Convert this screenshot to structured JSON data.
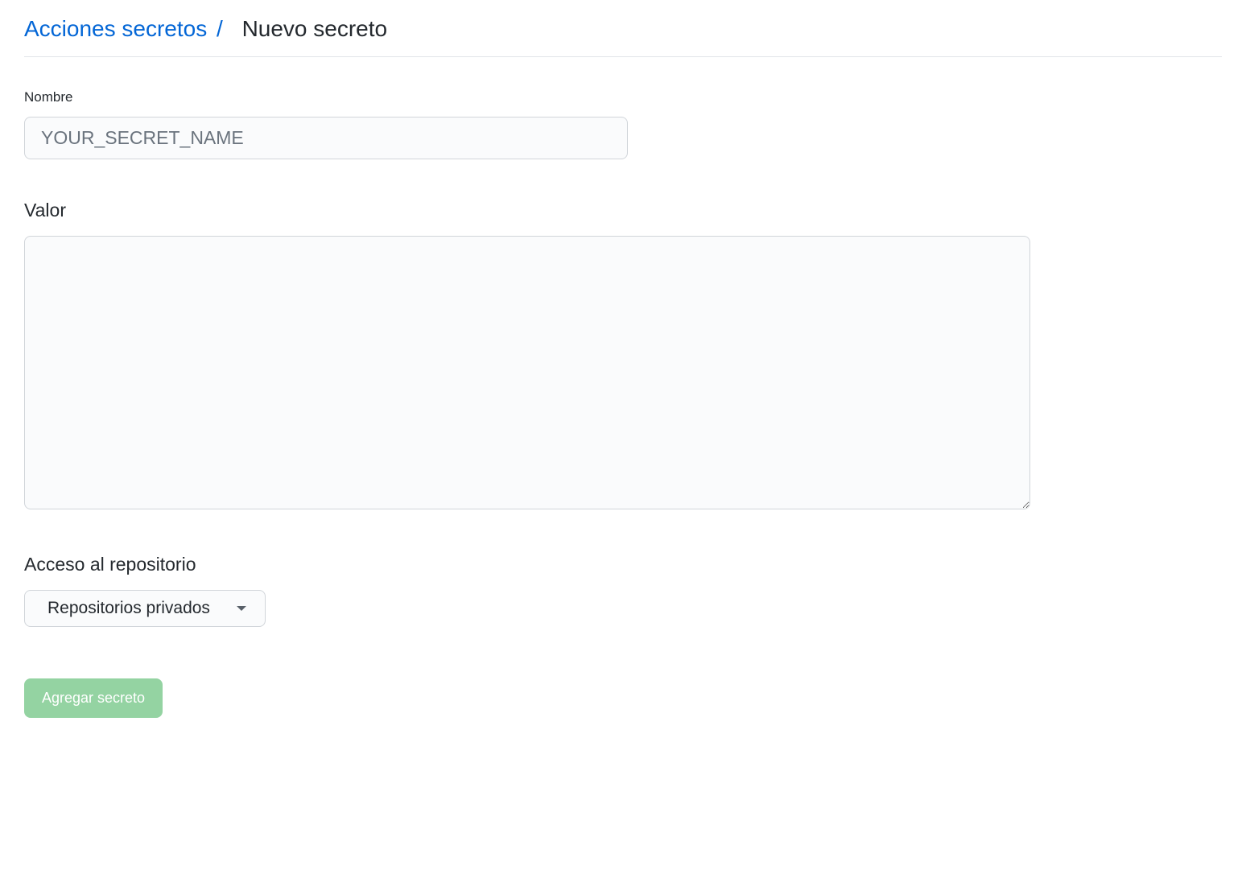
{
  "breadcrumb": {
    "link_label": "Acciones secretos",
    "current": "Nuevo secreto"
  },
  "form": {
    "name": {
      "label": "Nombre",
      "placeholder": "YOUR_SECRET_NAME",
      "value": ""
    },
    "value_field": {
      "label": "Valor",
      "value": ""
    },
    "repo_access": {
      "label": "Acceso al repositorio",
      "selected": "Repositorios privados"
    },
    "submit_label": "Agregar secreto"
  }
}
